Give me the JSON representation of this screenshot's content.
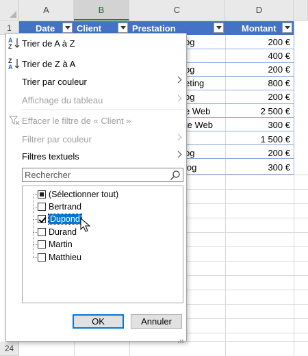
{
  "spreadsheet": {
    "column_headers": [
      "A",
      "B",
      "C",
      "D"
    ],
    "row_headers": [
      "1",
      "24"
    ],
    "table": {
      "headers": {
        "date": "Date",
        "client": "Client",
        "prestation": "Prestation",
        "montant": "Montant"
      },
      "prestation_visible": [
        "og",
        "",
        "og",
        "eting",
        "og",
        "e Web",
        "te Web",
        "",
        "og",
        "log"
      ],
      "montant": [
        "200 €",
        "400 €",
        "200 €",
        "800 €",
        "200 €",
        "2 500 €",
        "300 €",
        "1 500 €",
        "200 €",
        "300 €"
      ]
    }
  },
  "filter_menu": {
    "sort_asc": "Trier de A à Z",
    "sort_desc": "Trier de Z à A",
    "sort_by_color": "Trier par couleur",
    "table_view": "Affichage du tableau",
    "clear_filter": "Effacer le filtre de « Client »",
    "filter_by_color": "Filtrer par couleur",
    "text_filters": "Filtres textuels",
    "search_placeholder": "Rechercher",
    "items": [
      {
        "label": "(Sélectionner tout)",
        "state": "partial"
      },
      {
        "label": "Bertrand",
        "state": "unchecked"
      },
      {
        "label": "Dupond",
        "state": "checked"
      },
      {
        "label": "Durand",
        "state": "unchecked"
      },
      {
        "label": "Martin",
        "state": "unchecked"
      },
      {
        "label": "Matthieu",
        "state": "unchecked"
      }
    ],
    "ok": "OK",
    "cancel": "Annuler"
  },
  "colors": {
    "table_header": "#4472c4",
    "selection": "#0078d7",
    "column_selected": "#217346"
  }
}
